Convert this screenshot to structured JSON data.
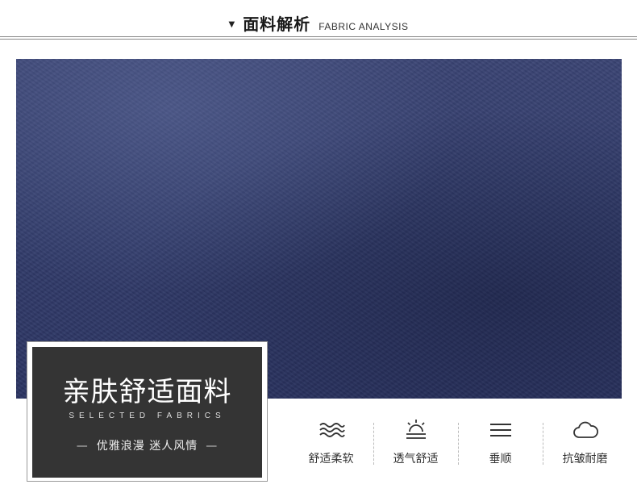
{
  "header": {
    "marker": "▼",
    "title_zh": "面料解析",
    "title_en": "FABRIC ANALYSIS"
  },
  "card": {
    "title": "亲肤舒适面料",
    "subtitle": "SELECTED FABRICS",
    "slogan_dash_left": "—",
    "slogan": "优雅浪漫 迷人风情",
    "slogan_dash_right": "—"
  },
  "features": [
    {
      "icon": "waves-icon",
      "label": "舒适柔软"
    },
    {
      "icon": "sun-horizon-icon",
      "label": "透气舒适"
    },
    {
      "icon": "horizontal-lines-icon",
      "label": "垂顺"
    },
    {
      "icon": "cloud-icon",
      "label": "抗皱耐磨"
    }
  ],
  "colors": {
    "fabric": "#323c6b",
    "card_bg": "#343434",
    "text": "#222222"
  }
}
